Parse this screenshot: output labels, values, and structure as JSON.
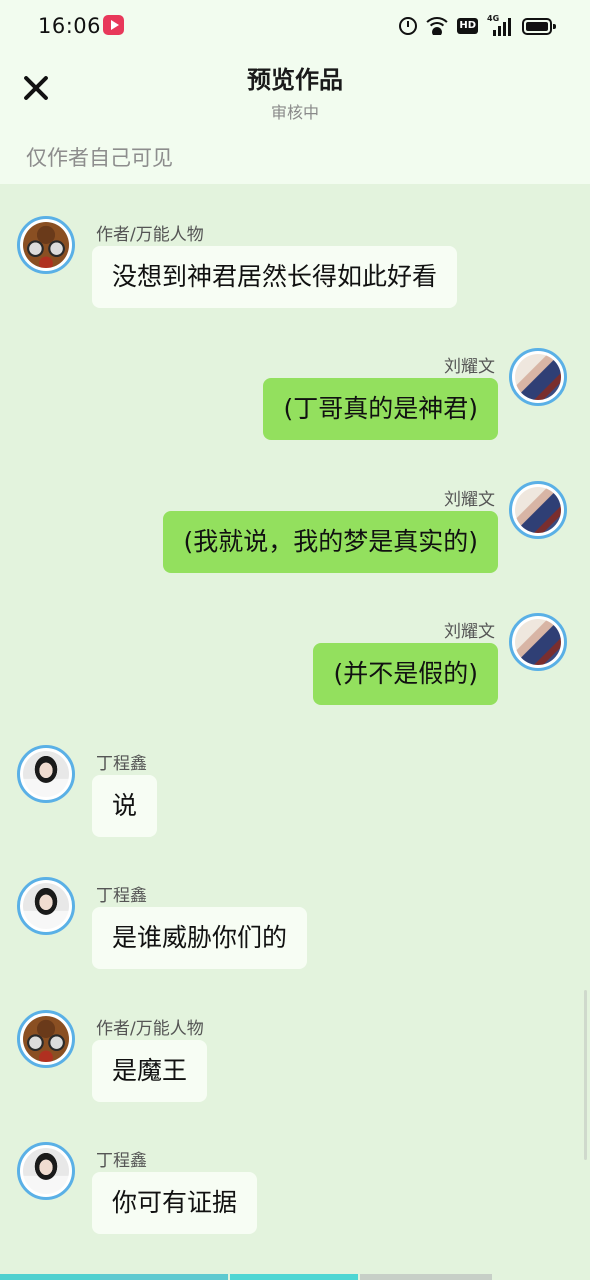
{
  "status": {
    "time": "16:06",
    "network": "4G",
    "hd": "HD"
  },
  "header": {
    "title": "预览作品",
    "subtitle": "审核中",
    "visibility": "仅作者自己可见"
  },
  "messages": [
    {
      "side": "left",
      "name": "作者/万能人物",
      "text": "没想到神君居然长得如此好看",
      "avatar": "author"
    },
    {
      "side": "right",
      "name": "刘耀文",
      "text": "(丁哥真的是神君)",
      "avatar": "liu"
    },
    {
      "side": "right",
      "name": "刘耀文",
      "text": "(我就说，我的梦是真实的)",
      "avatar": "liu"
    },
    {
      "side": "right",
      "name": "刘耀文",
      "text": "(并不是假的)",
      "avatar": "liu"
    },
    {
      "side": "left",
      "name": "丁程鑫",
      "text": "说",
      "avatar": "ding"
    },
    {
      "side": "left",
      "name": "丁程鑫",
      "text": "是谁威胁你们的",
      "avatar": "ding"
    },
    {
      "side": "left",
      "name": "作者/万能人物",
      "text": "是魔王",
      "avatar": "author"
    },
    {
      "side": "left",
      "name": "丁程鑫",
      "text": "你可有证据",
      "avatar": "ding"
    }
  ],
  "colors": {
    "accent": "#5ab0e6",
    "right_bubble": "#93e05e",
    "background": "#e3f3dd"
  }
}
